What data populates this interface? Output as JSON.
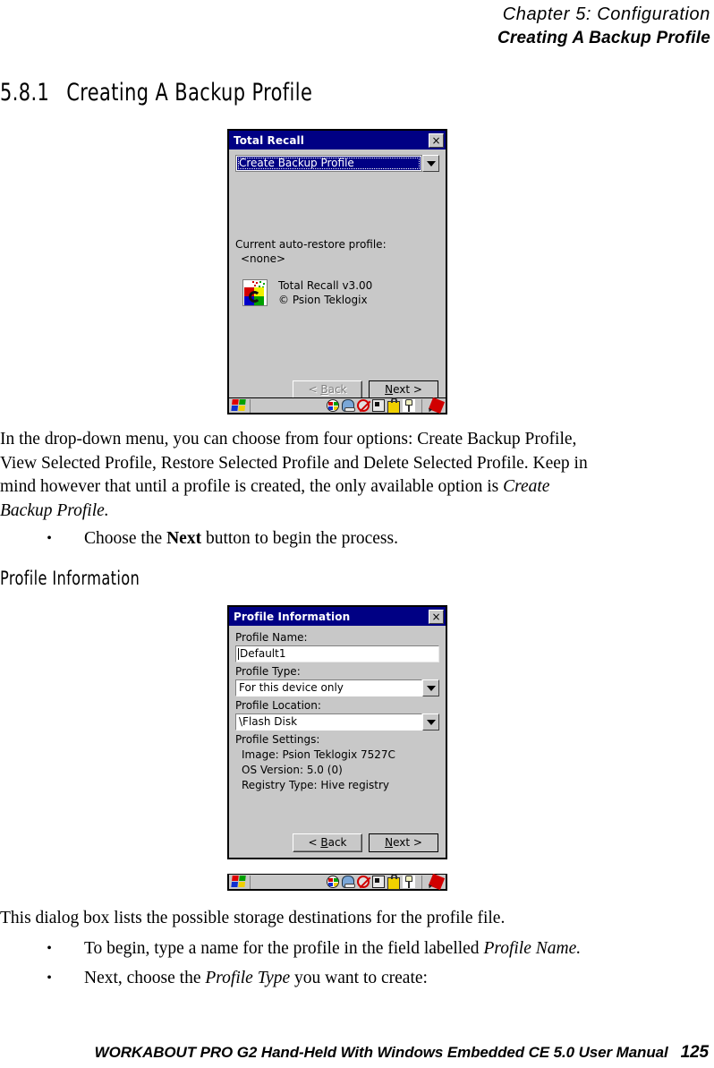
{
  "runhead": {
    "chapter": "Chapter  5:  Configuration",
    "section": "Creating A Backup Profile"
  },
  "heading": {
    "number": "5.8.1",
    "title": "Creating A Backup Profile"
  },
  "subheading": {
    "title": "Profile Information"
  },
  "dialog1": {
    "title": "Total Recall",
    "close_label": "×",
    "combo_value": "Create Backup Profile",
    "autorestore_label": "Current auto-restore profile:",
    "autorestore_value": "<none>",
    "app_name": "Total Recall v3.00",
    "app_copyright": "© Psion Teklogix",
    "back_label_prefix": "< ",
    "back_label_accel": "B",
    "back_label_rest": "ack",
    "next_label_accel": "N",
    "next_label_rest": "ext >"
  },
  "dialog2": {
    "title": "Profile Information",
    "close_label": "×",
    "profile_name_label": "Profile Name:",
    "profile_name_value": "Default1",
    "profile_type_label": "Profile Type:",
    "profile_type_value": "For this device only",
    "profile_location_label": "Profile Location:",
    "profile_location_value": "\\Flash Disk",
    "profile_settings_label": "Profile Settings:",
    "setting_image": "Image: Psion Teklogix 7527C",
    "setting_os": "OS Version: 5.0 (0)",
    "setting_registry": "Registry Type: Hive registry",
    "back_label_prefix": "< ",
    "back_label_accel": "B",
    "back_label_rest": "ack",
    "next_label_accel": "N",
    "next_label_rest": "ext >"
  },
  "body": {
    "para1_line1": "In the drop-down menu, you can choose from four options: Create Backup Profile,",
    "para1_line2": "View Selected Profile, Restore Selected Profile and Delete Selected Profile. Keep in",
    "para1_line3a": "mind however that until a profile is created, the only available option is ",
    "para1_line3b": "Create",
    "para1_line4": "Backup Profile.",
    "bullet1_a": "Choose the ",
    "bullet1_b": "Next",
    "bullet1_c": " button to begin the process.",
    "para2": "This dialog box lists the possible storage destinations for the profile file.",
    "bullet2_a": "To begin, type a name for the profile in the field labelled ",
    "bullet2_b": "Profile Name.",
    "bullet3_a": "Next, choose the ",
    "bullet3_b": "Profile Type",
    "bullet3_c": " you want to create:"
  },
  "footer": {
    "manual": "WORKABOUT PRO G2 Hand-Held With Windows Embedded CE 5.0 User Manual",
    "page": "125"
  },
  "colors": {
    "titlebar": "#000084",
    "dialog_face": "#c8c8c8",
    "selection": "#000084"
  }
}
